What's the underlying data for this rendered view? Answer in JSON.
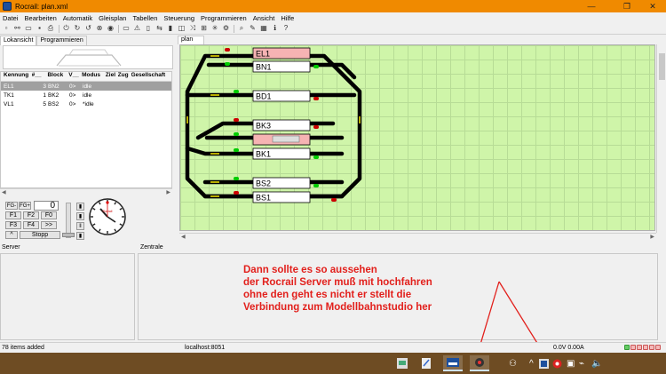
{
  "window": {
    "title": "Rocrail: plan.xml",
    "minimize": "—",
    "maximize": "❐",
    "close": "✕"
  },
  "menu": [
    "Datei",
    "Bearbeiten",
    "Automatik",
    "Gleisplan",
    "Tabellen",
    "Steuerung",
    "Programmieren",
    "Ansicht",
    "Hilfe"
  ],
  "left_tabs": [
    "Lokansicht",
    "Programmieren"
  ],
  "loco_table": {
    "columns": [
      "Kennung",
      "#__",
      "Block",
      "V__",
      "Modus",
      "Ziel",
      "Zug",
      "Gesellschaft"
    ],
    "rows": [
      {
        "id": "EL1",
        "num": "3",
        "block": "BN2",
        "v": "0>",
        "mode": "idle",
        "selected": true
      },
      {
        "id": "TK1",
        "num": "1",
        "block": "BK2",
        "v": "0>",
        "mode": "idle",
        "selected": false
      },
      {
        "id": "VL1",
        "num": "5",
        "block": "BS2",
        "v": "0>",
        "mode": "*idle",
        "selected": false
      }
    ]
  },
  "control": {
    "fg_minus": "FG-",
    "fg_plus": "FG+",
    "speed": "0",
    "fbuttons": [
      "F1",
      "F2",
      "F0",
      "F3",
      "F4",
      ">>"
    ],
    "up": "^",
    "stop": "Stopp",
    "clock_brand": "Rocrail"
  },
  "plan_tab": "plan",
  "blocks": [
    "EL1",
    "BN1",
    "BD1",
    "BK3",
    "BK2",
    "BK1",
    "BS2",
    "BS1"
  ],
  "panes": {
    "server": "Server",
    "zentrale": "Zentrale"
  },
  "status": {
    "items_added": "78 items added",
    "host": "localhost:8051",
    "power": "0.0V 0.00A"
  },
  "annotation": [
    "Dann sollte es so aussehen",
    "der Rocrail Server muß mit hochfahren",
    "ohne den geht es nicht er stellt die",
    "Verbindung zum Modellbahnstudio her"
  ],
  "colors": {
    "titlebar": "#f08a00",
    "plan_bg": "#cff5a9",
    "taskbar": "#6e4c23",
    "annotation": "#e2201c",
    "selected_row": "#a0a0a0"
  }
}
